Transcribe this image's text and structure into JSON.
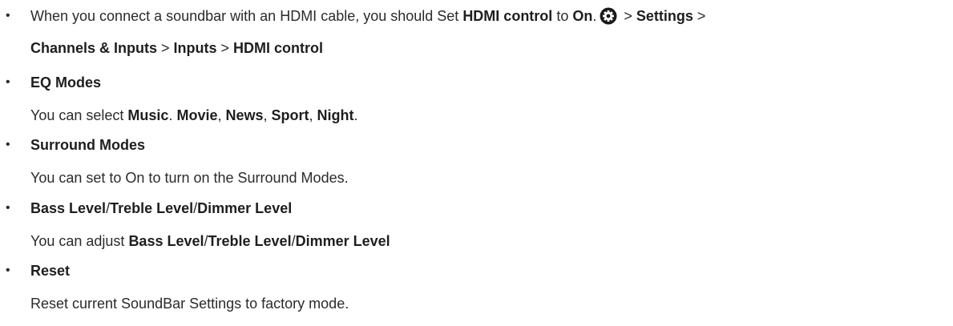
{
  "bullet_char": "•",
  "items": [
    {
      "intro": "When you connect a soundbar with an HDMI cable, you should Set ",
      "term": "HDMI control",
      "mid": " to ",
      "on_word": "On",
      "period": ".",
      "icon": "gear-icon",
      "sep1": " > ",
      "settings": "Settings",
      "sep2": " >",
      "channels": "Channels & Inputs",
      "sep3": " >  ",
      "inputs": "Inputs",
      "sep4": " > ",
      "hdmi_control": "HDMI control"
    },
    {
      "heading": "EQ Modes",
      "desc_prefix": "You can select ",
      "music": "Music",
      "sep_a": ". ",
      "movie": "Movie",
      "sep_b": ", ",
      "news": "News",
      "sep_c": ", ",
      "sport": "Sport",
      "sep_d": ", ",
      "night": "Night",
      "end": "."
    },
    {
      "heading": "Surround Modes",
      "desc": "You can set to On to turn on the Surround Modes."
    },
    {
      "heading_bass": "Bass Level",
      "slash1": "/",
      "heading_treble": "Treble Level",
      "slash2": "/",
      "heading_dimmer": "Dimmer Level",
      "desc_prefix": "You can adjust ",
      "bass": "Bass Level",
      "slash3": "/",
      "treble": "Treble Level",
      "slash4": "/",
      "dimmer": "Dimmer Level"
    },
    {
      "heading": "Reset",
      "desc": "Reset current SoundBar Settings to factory mode."
    }
  ]
}
